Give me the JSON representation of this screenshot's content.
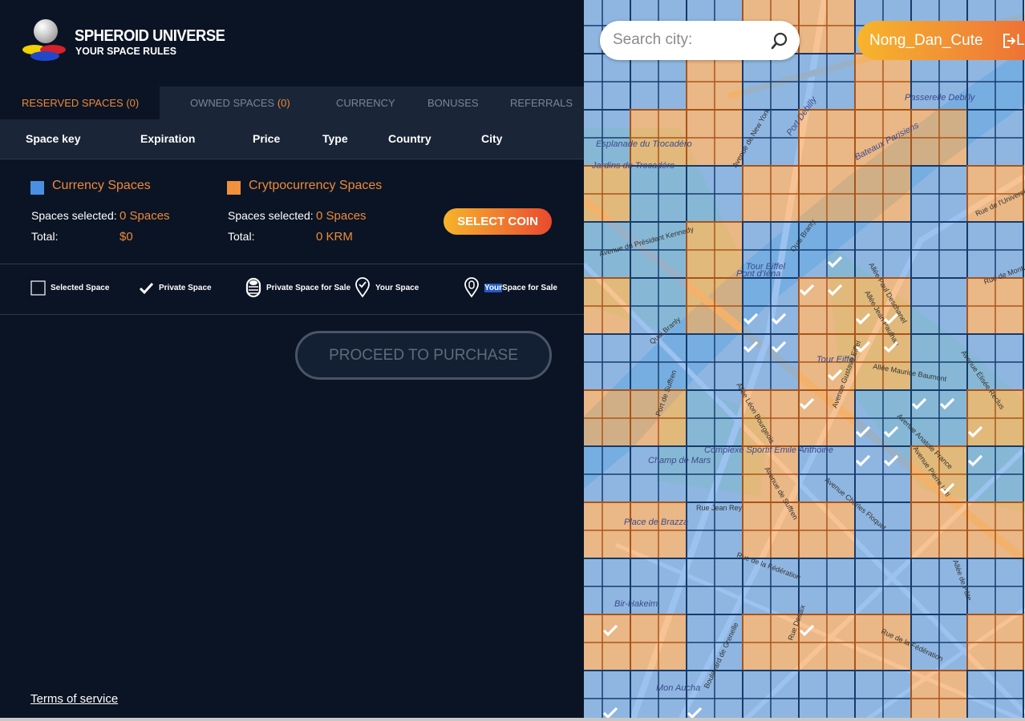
{
  "brand": {
    "name": "SPHEROID UNIVERSE",
    "tagline": "YOUR SPACE RULES"
  },
  "tabs": [
    {
      "label": "RESERVED SPACES",
      "count": "(0)",
      "active": true
    },
    {
      "label": "OWNED SPACES",
      "count": "(0)",
      "active": false
    },
    {
      "label": "CURRENCY",
      "active": false
    },
    {
      "label": "BONUSES",
      "active": false
    },
    {
      "label": "REFERRALS",
      "active": false
    }
  ],
  "table": {
    "headers": [
      "Space key",
      "Expiration",
      "Price",
      "Type",
      "Country",
      "City"
    ]
  },
  "currency_spaces": {
    "title": "Currency Spaces",
    "selected_label": "Spaces selected:",
    "selected_value": "0 Spaces",
    "total_label": "Total:",
    "total_value": "$0",
    "color": "#4a90e2"
  },
  "crypto_spaces": {
    "title": "Crytpocurrency Spaces",
    "selected_label": "Spaces selected:",
    "selected_value": "0 Spaces",
    "total_label": "Total:",
    "total_value": "0 KRM",
    "color": "#f0913d"
  },
  "select_coin_label": "SELECT COIN",
  "legend": [
    {
      "icon": "empty-square-icon",
      "label": "Selected Space"
    },
    {
      "icon": "checkmark-icon",
      "label": "Private Space"
    },
    {
      "icon": "coin-stack-icon",
      "label": "Private Space for Sale"
    },
    {
      "icon": "pin-check-icon",
      "label": "Your Space"
    },
    {
      "icon": "pin-coin-icon",
      "label_highlight": "Your",
      "label_rest": " Space for Sale"
    }
  ],
  "proceed_label": "PROCEED TO PURCHASE",
  "terms_label": "Terms of service",
  "map": {
    "search_placeholder": "Search city:",
    "username": "Nong_Dan_Cute",
    "logout_label": "L",
    "places": [
      "Bateaux Parisiens",
      "Tour Eiffel",
      "Tour Eiffel",
      "Passerelle Debilly",
      "Port Debilly",
      "Pont d'Iéna",
      "Esplanade du Trocadéro",
      "Jardins du Trocadéro",
      "Champ de Mars",
      "Bir-Hakeim",
      "Place de Brazza",
      "Complexe Sportif Emile Anthoine",
      "Mon Aucha",
      "Avenue de New York",
      "Quai Branly",
      "Allée Paul Deschanel",
      "Allée Jean Paulhan",
      "Avenue Gustave Eiffel",
      "Avenue Charles Floquet",
      "Avenue de Suffren",
      "Rue de la Fédération",
      "Boulevard de Grenelle",
      "Quai Branly",
      "Allée Léon Bourgeois",
      "Allée Maurice Baumont",
      "Avenue Anatole France",
      "Avenue Élisée Reclus",
      "Port de Suffren",
      "Rue Jean Rey",
      "Rue de Monttessuy",
      "Allée de Pâte",
      "Rue Desaix",
      "Avenue Pierre Loti",
      "Rue de l'Université",
      "Avenue du Président Kennedy",
      "Rue de la Fédération"
    ]
  }
}
